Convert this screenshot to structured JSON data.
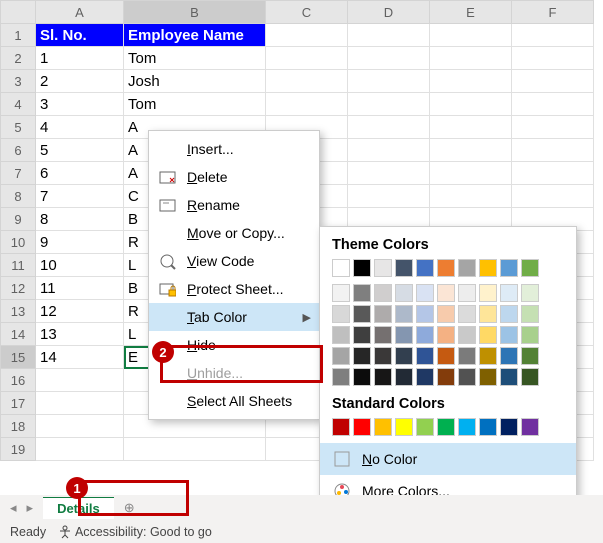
{
  "cols": [
    "A",
    "B",
    "C",
    "D",
    "E",
    "F"
  ],
  "rows": [
    1,
    2,
    3,
    4,
    5,
    6,
    7,
    8,
    9,
    10,
    11,
    12,
    13,
    14,
    15,
    16,
    17,
    18,
    19
  ],
  "hdrA": "Sl. No.",
  "hdrB": "Employee Name",
  "data": [
    {
      "a": "1",
      "b": "Tom"
    },
    {
      "a": "2",
      "b": "Josh"
    },
    {
      "a": "3",
      "b": "Tom"
    },
    {
      "a": "4",
      "b": "A"
    },
    {
      "a": "5",
      "b": "A"
    },
    {
      "a": "6",
      "b": "A"
    },
    {
      "a": "7",
      "b": "C"
    },
    {
      "a": "8",
      "b": "B"
    },
    {
      "a": "9",
      "b": "R"
    },
    {
      "a": "10",
      "b": "L"
    },
    {
      "a": "11",
      "b": "B"
    },
    {
      "a": "12",
      "b": "R"
    },
    {
      "a": "13",
      "b": "L"
    },
    {
      "a": "14",
      "b": "E"
    }
  ],
  "menu": {
    "insert": "nsert...",
    "delete": "elete",
    "rename": "ename",
    "move": "ove or Copy...",
    "view": "iew Code",
    "protect": "rotect Sheet...",
    "tabcolor": "ab Color",
    "hide": "ide",
    "unhide": "nhide...",
    "selectall": "elect All Sheets",
    "k_insert": "I",
    "k_delete": "D",
    "k_rename": "R",
    "k_move": "M",
    "k_view": "V",
    "k_protect": "P",
    "k_tab": "T",
    "k_hide": "H",
    "k_unhide": "U",
    "k_select": "S"
  },
  "sub": {
    "theme": "Theme Colors",
    "std": "Standard Colors",
    "nocolor": "o Color",
    "more": "ore Colors...",
    "k_no": "N",
    "k_more": "M"
  },
  "theme_row1": [
    "#ffffff",
    "#000000",
    "#e7e6e6",
    "#44546a",
    "#4472c4",
    "#ed7d31",
    "#a5a5a5",
    "#ffc000",
    "#5b9bd5",
    "#70ad47"
  ],
  "tints": [
    [
      "#f2f2f2",
      "#7f7f7f",
      "#d0cece",
      "#d6dce4",
      "#d9e2f3",
      "#fbe5d5",
      "#ededed",
      "#fff2cc",
      "#deebf6",
      "#e2efd9"
    ],
    [
      "#d8d8d8",
      "#595959",
      "#aeabab",
      "#adb9ca",
      "#b4c6e7",
      "#f7cbac",
      "#dbdbdb",
      "#fee599",
      "#bdd7ee",
      "#c5e0b3"
    ],
    [
      "#bfbfbf",
      "#3f3f3f",
      "#757070",
      "#8496b0",
      "#8eaadb",
      "#f4b183",
      "#c9c9c9",
      "#ffd965",
      "#9cc3e5",
      "#a8d08d"
    ],
    [
      "#a5a5a5",
      "#262626",
      "#3a3838",
      "#323f4f",
      "#2f5496",
      "#c55a11",
      "#7b7b7b",
      "#bf9000",
      "#2e75b5",
      "#538135"
    ],
    [
      "#7f7f7f",
      "#0c0c0c",
      "#171616",
      "#222a35",
      "#1f3864",
      "#833c0b",
      "#525252",
      "#7f6000",
      "#1e4e79",
      "#375623"
    ]
  ],
  "std": [
    "#c00000",
    "#ff0000",
    "#ffc000",
    "#ffff00",
    "#92d050",
    "#00b050",
    "#00b0f0",
    "#0070c0",
    "#002060",
    "#7030a0"
  ],
  "tab": {
    "nav_l": "◂",
    "nav_r": "▸",
    "name": "Details",
    "plus": "⊕"
  },
  "status": {
    "ready": "Ready",
    "acc": "Accessibility: Good to go"
  },
  "ann": {
    "a1": "1",
    "a2": "2"
  },
  "chart_data": {
    "type": "table",
    "categories": [
      "Sl. No.",
      "Employee Name"
    ],
    "values": [
      [
        1,
        "Tom"
      ],
      [
        2,
        "Josh"
      ],
      [
        3,
        "Tom"
      ],
      [
        4,
        "A"
      ],
      [
        5,
        "A"
      ],
      [
        6,
        "A"
      ],
      [
        7,
        "C"
      ],
      [
        8,
        "B"
      ],
      [
        9,
        "R"
      ],
      [
        10,
        "L"
      ],
      [
        11,
        "B"
      ],
      [
        12,
        "R"
      ],
      [
        13,
        "L"
      ],
      [
        14,
        "E"
      ]
    ]
  }
}
